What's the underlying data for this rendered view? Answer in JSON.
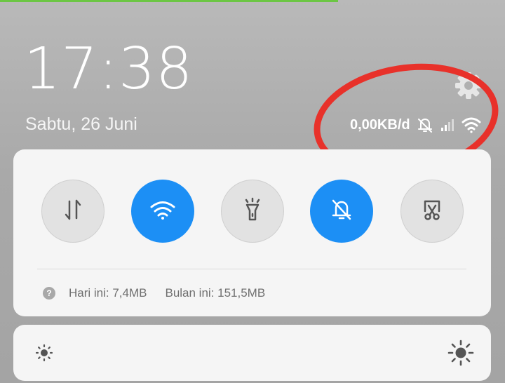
{
  "header": {
    "time": "17:38",
    "date": "Sabtu, 26 Juni"
  },
  "status_bar": {
    "network_speed": "0,00KB/d",
    "icons": [
      "bell-muted-icon",
      "cellular-signal-icon",
      "wifi-icon"
    ]
  },
  "quick_settings": {
    "toggles": [
      {
        "id": "mobile-data",
        "icon": "data-transfer-icon",
        "state": "off"
      },
      {
        "id": "wifi",
        "icon": "wifi-icon",
        "state": "on"
      },
      {
        "id": "flashlight",
        "icon": "flashlight-icon",
        "state": "off"
      },
      {
        "id": "silent",
        "icon": "bell-muted-icon",
        "state": "on"
      },
      {
        "id": "screenshot",
        "icon": "screenshot-scissors-icon",
        "state": "off"
      }
    ],
    "data_usage": {
      "today": "Hari ini: 7,4MB",
      "month": "Bulan ini: 151,5MB"
    }
  },
  "brightness": {
    "min_icon": "sun-small-icon",
    "max_icon": "sun-large-icon"
  },
  "colors": {
    "active": "#1c8ff5",
    "inactive": "#e2e2e2",
    "annotation": "#e8312a",
    "progress": "#6cc644"
  }
}
